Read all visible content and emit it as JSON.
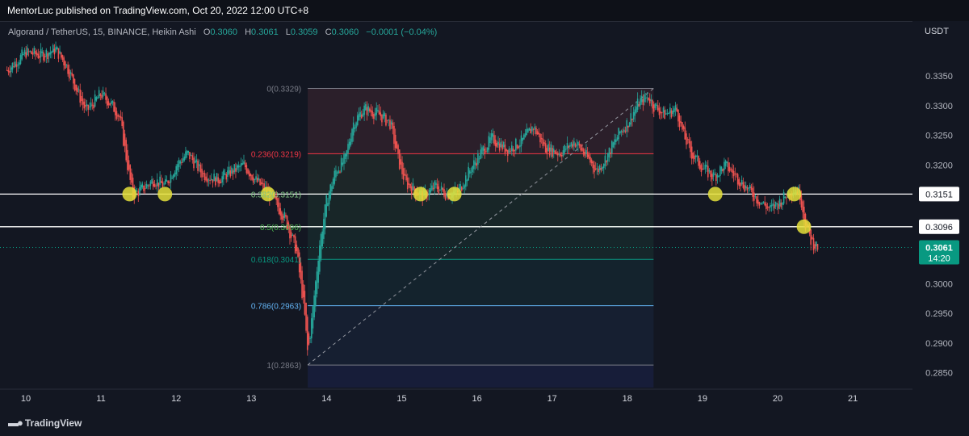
{
  "header": {
    "publisher": "MentorLuc published on TradingView.com, Oct 20, 2022 12:00 UTC+8"
  },
  "legend": {
    "symbol": "Algorand / TetherUS, 15, BINANCE, Heikin Ashi",
    "open_label": "O",
    "open": "0.3060",
    "high_label": "H",
    "high": "0.3061",
    "low_label": "L",
    "low": "0.3059",
    "close_label": "C",
    "close": "0.3060",
    "change": "−0.0001 (−0.04%)"
  },
  "currency": "USDT",
  "footer": {
    "brand": "TradingView"
  },
  "colors": {
    "background": "#131722",
    "up": "#26a69a",
    "down": "#ef5350",
    "fib_0": "#787b86",
    "fib_236": "#f23645",
    "fib_382": "#81c784",
    "fib_5": "#4caf50",
    "fib_618": "#089981",
    "fib_786": "#64b5f6",
    "fib_1": "#787b86",
    "marker": "#e5e03a",
    "price_tag": "#089981"
  },
  "chart_data": {
    "type": "candlestick",
    "style": "Heikin Ashi",
    "timeframe": "15",
    "ylim": [
      0.2825,
      0.341
    ],
    "xlim": [
      9.75,
      21.5
    ],
    "y_ticks": [
      "0.3350",
      "0.3300",
      "0.3250",
      "0.3200",
      "0.3150",
      "0.3100",
      "0.3050",
      "0.3000",
      "0.2950",
      "0.2900",
      "0.2850"
    ],
    "x_ticks": [
      "10",
      "11",
      "12",
      "13",
      "14",
      "15",
      "16",
      "17",
      "18",
      "19",
      "20",
      "21"
    ],
    "price_path": [
      [
        9.75,
        0.336
      ],
      [
        10.0,
        0.339
      ],
      [
        10.2,
        0.3385
      ],
      [
        10.4,
        0.3395
      ],
      [
        10.55,
        0.3365
      ],
      [
        10.7,
        0.332
      ],
      [
        10.8,
        0.329
      ],
      [
        11.0,
        0.332
      ],
      [
        11.15,
        0.33
      ],
      [
        11.25,
        0.328
      ],
      [
        11.35,
        0.32
      ],
      [
        11.42,
        0.315
      ],
      [
        11.55,
        0.316
      ],
      [
        11.7,
        0.3175
      ],
      [
        11.85,
        0.3165
      ],
      [
        12.0,
        0.32
      ],
      [
        12.15,
        0.322
      ],
      [
        12.35,
        0.3185
      ],
      [
        12.55,
        0.3175
      ],
      [
        12.75,
        0.319
      ],
      [
        12.9,
        0.32
      ],
      [
        13.05,
        0.3175
      ],
      [
        13.25,
        0.315
      ],
      [
        13.45,
        0.311
      ],
      [
        13.6,
        0.3055
      ],
      [
        13.7,
        0.296
      ],
      [
        13.75,
        0.288
      ],
      [
        13.82,
        0.296
      ],
      [
        13.9,
        0.306
      ],
      [
        14.0,
        0.314
      ],
      [
        14.12,
        0.319
      ],
      [
        14.25,
        0.321
      ],
      [
        14.35,
        0.327
      ],
      [
        14.5,
        0.3295
      ],
      [
        14.7,
        0.3285
      ],
      [
        14.85,
        0.327
      ],
      [
        14.95,
        0.321
      ],
      [
        15.05,
        0.317
      ],
      [
        15.2,
        0.3155
      ],
      [
        15.3,
        0.3148
      ],
      [
        15.45,
        0.3165
      ],
      [
        15.6,
        0.315
      ],
      [
        15.75,
        0.3155
      ],
      [
        15.9,
        0.319
      ],
      [
        16.05,
        0.322
      ],
      [
        16.2,
        0.3245
      ],
      [
        16.4,
        0.3225
      ],
      [
        16.6,
        0.324
      ],
      [
        16.75,
        0.3265
      ],
      [
        16.9,
        0.323
      ],
      [
        17.1,
        0.322
      ],
      [
        17.3,
        0.324
      ],
      [
        17.45,
        0.3215
      ],
      [
        17.6,
        0.319
      ],
      [
        17.75,
        0.322
      ],
      [
        17.9,
        0.3255
      ],
      [
        18.0,
        0.327
      ],
      [
        18.15,
        0.3305
      ],
      [
        18.28,
        0.3315
      ],
      [
        18.35,
        0.33
      ],
      [
        18.5,
        0.3285
      ],
      [
        18.65,
        0.3295
      ],
      [
        18.75,
        0.325
      ],
      [
        18.85,
        0.322
      ],
      [
        19.0,
        0.3195
      ],
      [
        19.15,
        0.318
      ],
      [
        19.3,
        0.32
      ],
      [
        19.45,
        0.318
      ],
      [
        19.6,
        0.316
      ],
      [
        19.75,
        0.314
      ],
      [
        19.9,
        0.3125
      ],
      [
        20.05,
        0.314
      ],
      [
        20.15,
        0.3155
      ],
      [
        20.25,
        0.316
      ],
      [
        20.3,
        0.315
      ],
      [
        20.37,
        0.31
      ],
      [
        20.45,
        0.307
      ],
      [
        20.55,
        0.306
      ]
    ],
    "last_price": "0.3061",
    "countdown": "14:20",
    "last_price_value": 0.3061,
    "fib_retracement": {
      "x_range": [
        13.75,
        18.35
      ],
      "levels": [
        {
          "ratio": 0,
          "price": 0.3329,
          "label": "0(0.3329)"
        },
        {
          "ratio": 0.236,
          "price": 0.3219,
          "label": "0.236(0.3219)"
        },
        {
          "ratio": 0.382,
          "price": 0.3151,
          "label": "0.382(0.3151)"
        },
        {
          "ratio": 0.5,
          "price": 0.3096,
          "label": "0.5(0.3096)"
        },
        {
          "ratio": 0.618,
          "price": 0.3041,
          "label": "0.618(0.3041)"
        },
        {
          "ratio": 0.786,
          "price": 0.2963,
          "label": "0.786(0.2963)"
        },
        {
          "ratio": 1,
          "price": 0.2863,
          "label": "1(0.2863)"
        }
      ]
    },
    "horizontal_lines": [
      {
        "price": 0.3151,
        "label": "0.3151"
      },
      {
        "price": 0.3096,
        "label": "0.3096"
      }
    ],
    "markers": [
      {
        "x": 11.38,
        "y": 0.3151
      },
      {
        "x": 11.85,
        "y": 0.3151
      },
      {
        "x": 13.22,
        "y": 0.3151
      },
      {
        "x": 15.25,
        "y": 0.3151
      },
      {
        "x": 15.7,
        "y": 0.3151
      },
      {
        "x": 19.17,
        "y": 0.3151
      },
      {
        "x": 20.22,
        "y": 0.3151
      },
      {
        "x": 20.35,
        "y": 0.3096
      }
    ]
  }
}
